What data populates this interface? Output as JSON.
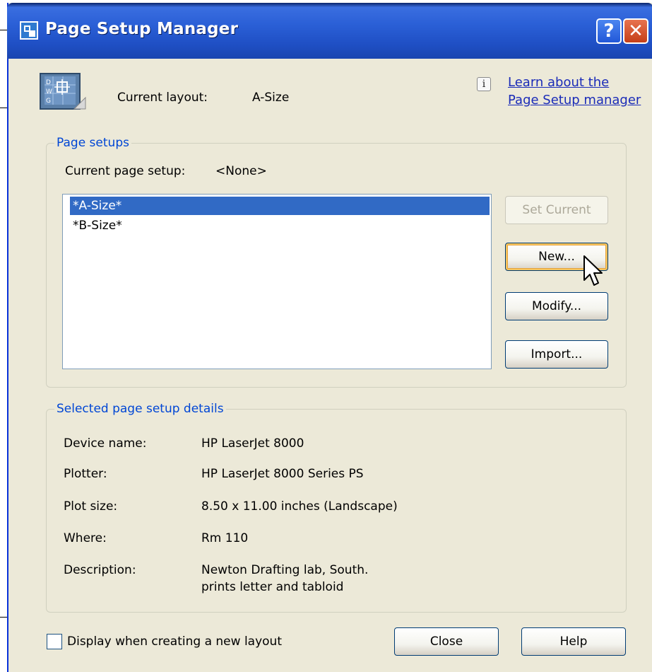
{
  "window": {
    "title": "Page Setup Manager",
    "help_glyph": "?",
    "close_glyph": "✕"
  },
  "header": {
    "current_layout_label": "Current layout:",
    "current_layout_value": "A-Size",
    "info_glyph": "i",
    "learn_link_line1": "Learn about the",
    "learn_link_line2": "Page Setup manager"
  },
  "page_setups": {
    "group_title": "Page setups",
    "current_setup_label": "Current page setup:",
    "current_setup_value": "<None>",
    "items": [
      {
        "label": "*A-Size*",
        "selected": true
      },
      {
        "label": "*B-Size*",
        "selected": false
      }
    ],
    "buttons": {
      "set_current": "Set Current",
      "new": "New...",
      "modify": "Modify...",
      "import": "Import..."
    }
  },
  "details": {
    "group_title": "Selected page setup details",
    "rows": [
      {
        "label": "Device name:",
        "value": "HP LaserJet 8000"
      },
      {
        "label": "Plotter:",
        "value": "HP LaserJet 8000 Series PS"
      },
      {
        "label": "Plot size:",
        "value": "8.50 x 11.00 inches (Landscape)"
      },
      {
        "label": "Where:",
        "value": "Rm 110"
      },
      {
        "label": "Description:",
        "value": "Newton Drafting lab, South.",
        "value_line2": "prints letter and tabloid"
      }
    ]
  },
  "footer": {
    "checkbox_label": "Display when creating a new layout",
    "checkbox_checked": false,
    "close_button": "Close",
    "help_button": "Help"
  },
  "colors": {
    "titlebar": "#2a5fd6",
    "dialog_bg": "#ece9d8",
    "group_title": "#0046d5",
    "selection": "#316ac5",
    "link": "#1a2bb8"
  }
}
